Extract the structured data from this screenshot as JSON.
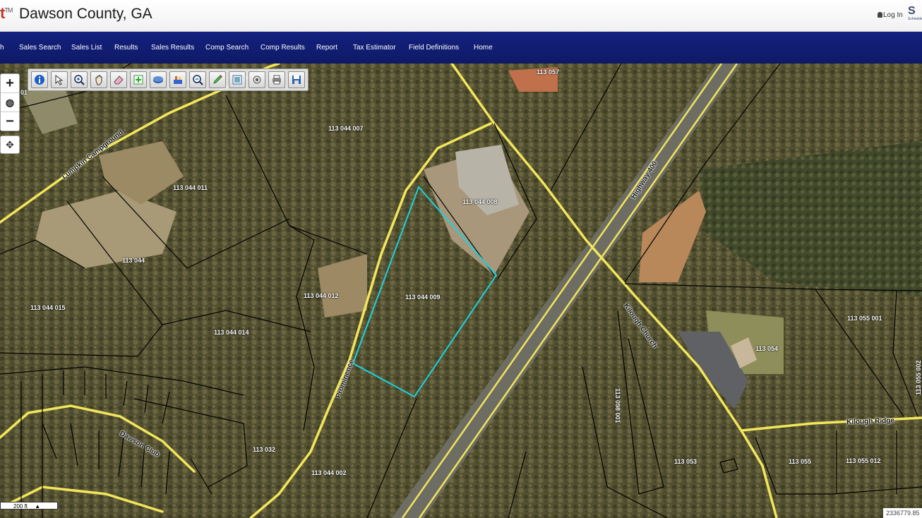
{
  "header": {
    "logo_text": "t",
    "logo_tm": "TM",
    "county_title": "Dawson County, GA",
    "login_label": "Log In",
    "brand_initial": "S",
    "brand_text": "Schneider"
  },
  "nav": {
    "items": [
      {
        "label": "h"
      },
      {
        "label": "Sales Search"
      },
      {
        "label": "Sales List"
      },
      {
        "label": "Results"
      },
      {
        "label": "Sales Results"
      },
      {
        "label": "Comp Search"
      },
      {
        "label": "Comp Results"
      },
      {
        "label": "Report"
      },
      {
        "label": "Tax Estimator"
      },
      {
        "label": "Field Definitions"
      },
      {
        "label": "Home"
      }
    ]
  },
  "map_controls": {
    "zoom_in": "+",
    "globe": "◍",
    "zoom_out": "−",
    "pan": "✥"
  },
  "toolbar": {
    "tools": [
      "identify-icon",
      "select-icon",
      "zoom-in-box-icon",
      "pan-icon",
      "eraser-icon",
      "add-icon",
      "layers-icon",
      "buffer-icon",
      "zoom-out-box-icon",
      "pencil-icon",
      "print-icon",
      "measure-icon",
      "print-preview-icon",
      "save-icon"
    ]
  },
  "scale": {
    "label": "200 ft"
  },
  "coords": {
    "label": "2336779.85"
  },
  "parcels": [
    {
      "id": "113 057"
    },
    {
      "id": "113 044 007"
    },
    {
      "id": "113 044 011"
    },
    {
      "id": "113 044 008"
    },
    {
      "id": "113 044"
    },
    {
      "id": "113 044 012"
    },
    {
      "id": "113 044 009"
    },
    {
      "id": "113 044 015"
    },
    {
      "id": "113 044 014"
    },
    {
      "id": "113 055 001"
    },
    {
      "id": "113 054"
    },
    {
      "id": "113 055 002"
    },
    {
      "id": "113 032"
    },
    {
      "id": "113 044 002"
    },
    {
      "id": "113 053"
    },
    {
      "id": "113 055"
    },
    {
      "id": "113 055 012"
    },
    {
      "id": "113 098 001"
    },
    {
      "id": "01"
    }
  ],
  "roads": [
    {
      "name": "Lumpkin Campground"
    },
    {
      "name": "Highway 400"
    },
    {
      "name": "Prominence"
    },
    {
      "name": "Kilough Church"
    },
    {
      "name": "Kilough Ridge"
    },
    {
      "name": "Dawson Club"
    }
  ],
  "colors": {
    "nav_bg": "#14217f",
    "road": "#f2e65a",
    "selected_parcel": "#19d3df",
    "parcel_line": "#000000"
  }
}
